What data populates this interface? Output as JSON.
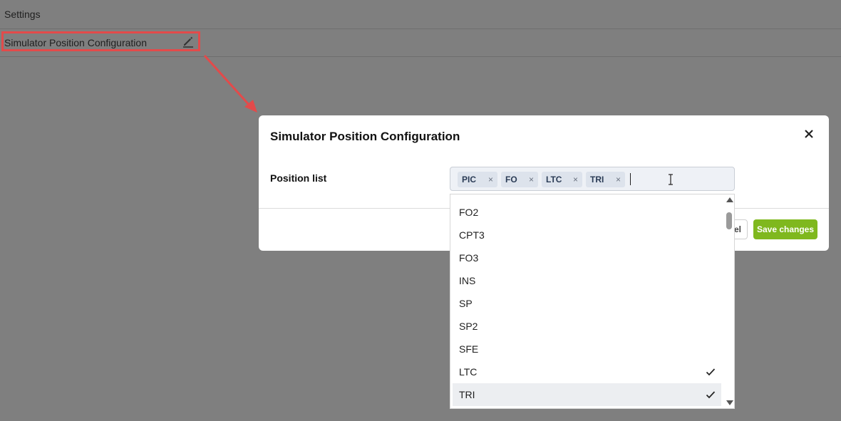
{
  "settings": {
    "title": "Settings",
    "row_label": "Simulator Position Configuration",
    "edit_icon": "pencil-icon"
  },
  "modal": {
    "title": "Simulator Position Configuration",
    "close_icon": "close-icon",
    "field_label": "Position list",
    "cancel_label": "el",
    "save_label": "Save changes",
    "save_color": "#7fb81e"
  },
  "tag_input": {
    "chips": [
      {
        "label": "PIC"
      },
      {
        "label": "FO"
      },
      {
        "label": "LTC"
      },
      {
        "label": "TRI"
      }
    ],
    "remove_glyph": "×"
  },
  "dropdown": {
    "options": [
      {
        "label": "FO2",
        "selected": false
      },
      {
        "label": "CPT3",
        "selected": false
      },
      {
        "label": "FO3",
        "selected": false
      },
      {
        "label": "INS",
        "selected": false
      },
      {
        "label": "SP",
        "selected": false
      },
      {
        "label": "SP2",
        "selected": false
      },
      {
        "label": "SFE",
        "selected": false
      },
      {
        "label": "LTC",
        "selected": true
      },
      {
        "label": "TRI",
        "selected": true,
        "hovered": true
      }
    ]
  },
  "annotation": {
    "color": "#e34a4a"
  }
}
